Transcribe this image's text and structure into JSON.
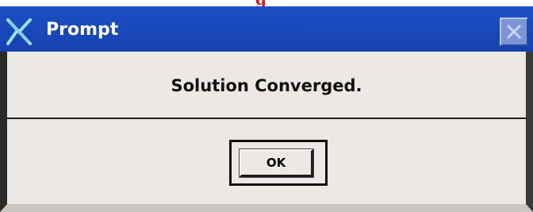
{
  "window": {
    "title": "Prompt",
    "title_icon": "x-logo-icon",
    "close_icon": "close-icon"
  },
  "dialog": {
    "message": "Solution Converged.",
    "ok_label": "OK"
  },
  "colors": {
    "titlebar": "#1542b0",
    "dialog_bg": "#ebe8e6",
    "text": "#111111"
  }
}
